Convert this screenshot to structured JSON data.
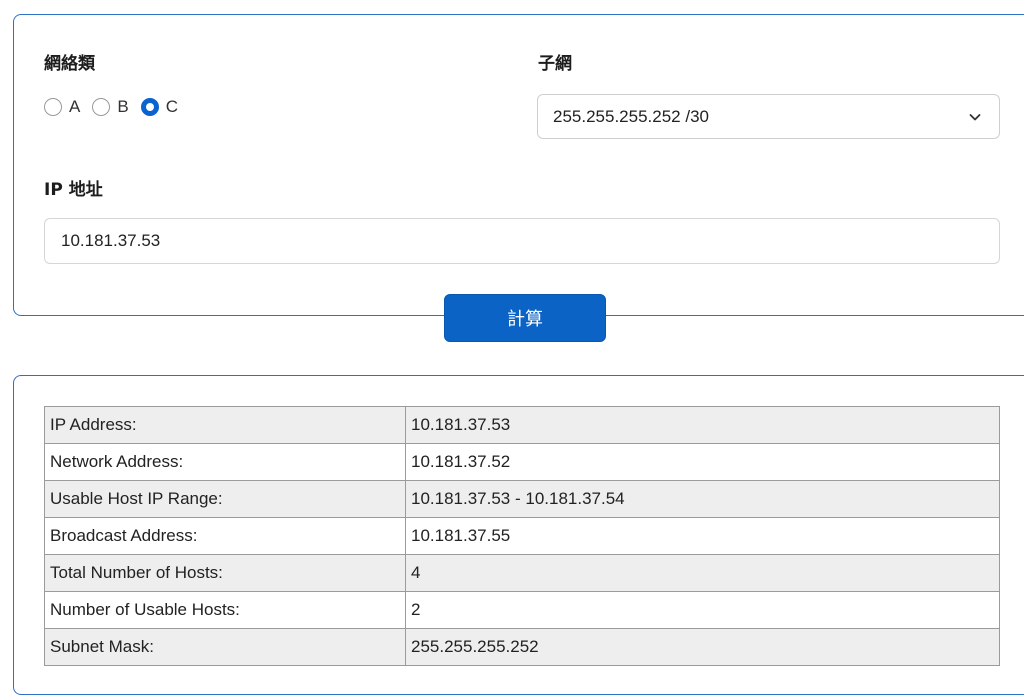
{
  "form": {
    "network_class_label": "網絡類",
    "network_classes": [
      {
        "label": "A",
        "checked": false
      },
      {
        "label": "B",
        "checked": false
      },
      {
        "label": "C",
        "checked": true
      }
    ],
    "subnet_label": "子網",
    "subnet_value": "255.255.255.252 /30",
    "ip_label": "IP 地址",
    "ip_value": "10.181.37.53",
    "calculate_label": "計算"
  },
  "colors": {
    "accent": "#0b63c6",
    "border": "#2f6fc4"
  },
  "result": {
    "rows": [
      {
        "key": "IP Address:",
        "value": "10.181.37.53"
      },
      {
        "key": "Network Address:",
        "value": "10.181.37.52"
      },
      {
        "key": "Usable Host IP Range:",
        "value": "10.181.37.53 - 10.181.37.54"
      },
      {
        "key": "Broadcast Address:",
        "value": "10.181.37.55"
      },
      {
        "key": "Total Number of Hosts:",
        "value": "4"
      },
      {
        "key": "Number of Usable Hosts:",
        "value": "2"
      },
      {
        "key": "Subnet Mask:",
        "value": "255.255.255.252"
      }
    ]
  }
}
